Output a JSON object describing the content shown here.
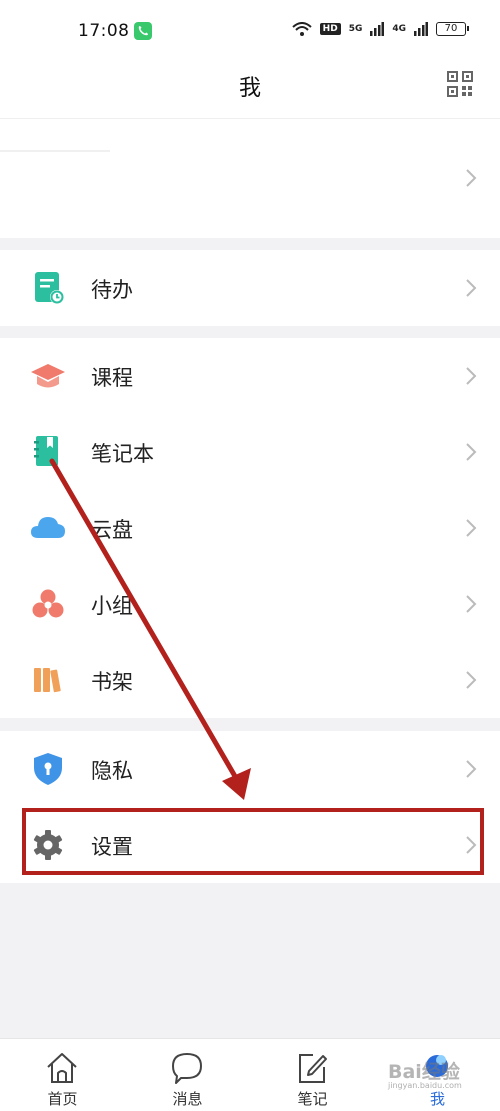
{
  "status_bar": {
    "time": "17:08",
    "hd": "HD",
    "net1": "5G",
    "net2": "4G",
    "battery": "70"
  },
  "header": {
    "title": "我"
  },
  "menu": {
    "todo": "待办",
    "course": "课程",
    "notebook": "笔记本",
    "cloud": "云盘",
    "group": "小组",
    "bookshelf": "书架",
    "privacy": "隐私",
    "settings": "设置"
  },
  "tabbar": {
    "home": "首页",
    "messages": "消息",
    "notes": "笔记",
    "me": "我"
  },
  "watermark": {
    "brand": "Bai经验",
    "site": "jingyan.baidu.com"
  },
  "colors": {
    "accent": "#2a6bd9",
    "annotation": "#b3211d",
    "todo": "#2bbf9f",
    "course": "#f07a6b",
    "cloud": "#4ba6ee"
  }
}
